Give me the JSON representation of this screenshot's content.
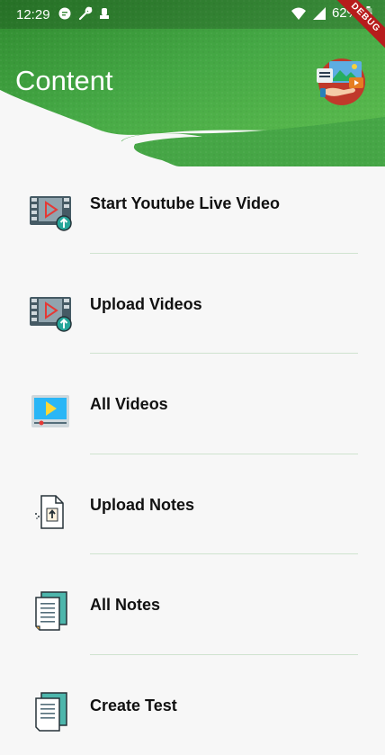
{
  "status_bar": {
    "time": "12:29",
    "battery": "62%",
    "icons": [
      "message-icon",
      "wrench-icon",
      "notification-icon",
      "wifi-icon",
      "signal-icon",
      "battery-icon"
    ]
  },
  "debug_banner": "DEBUG",
  "header": {
    "title": "Content",
    "accent_color": "#3f9f3f"
  },
  "items": [
    {
      "label": "Start Youtube Live Video",
      "icon": "video-upload-icon"
    },
    {
      "label": "Upload Videos",
      "icon": "video-upload-icon"
    },
    {
      "label": "All Videos",
      "icon": "video-player-icon"
    },
    {
      "label": "Upload Notes",
      "icon": "file-upload-icon"
    },
    {
      "label": "All Notes",
      "icon": "notes-icon"
    },
    {
      "label": "Create Test",
      "icon": "notes-icon"
    }
  ]
}
